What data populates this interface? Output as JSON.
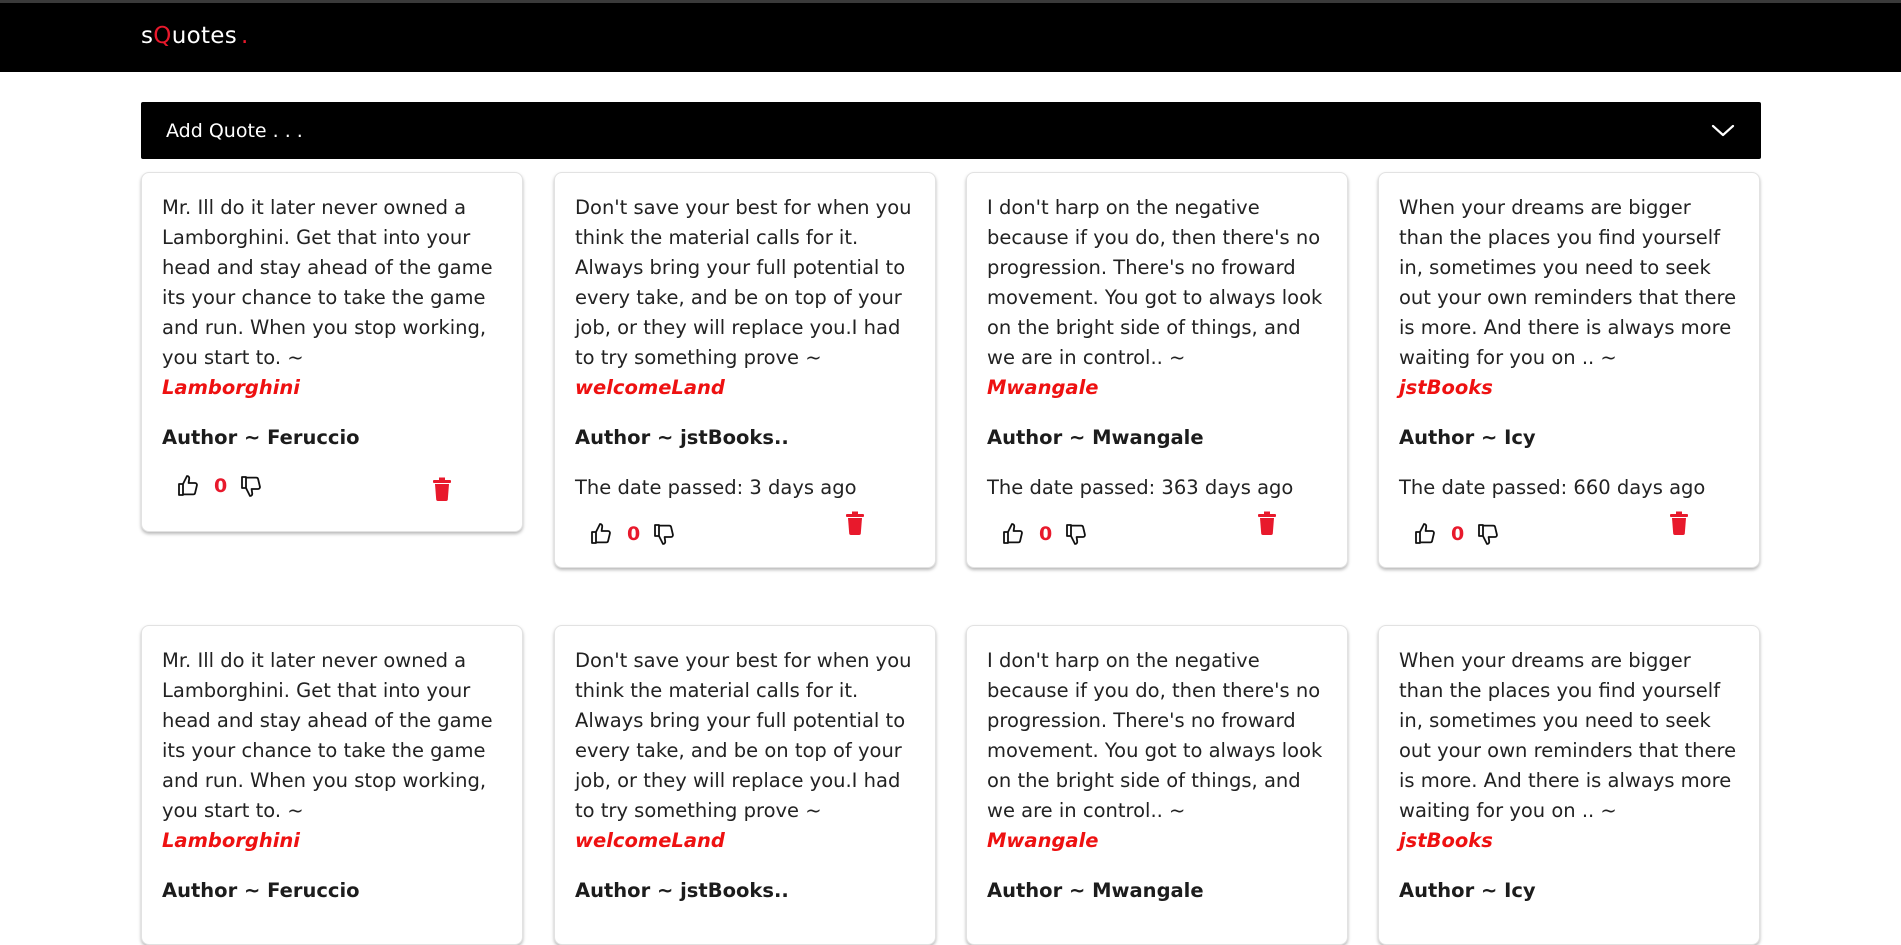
{
  "app": {
    "brand_prefix": "s",
    "brand_accent": "Q",
    "brand_suffix": "uotes",
    "brand_dot": ".",
    "accent_color": "#e8192c"
  },
  "add_quote": {
    "label": "Add Quote . . .",
    "toggle_icon": "chevron-down-icon"
  },
  "cards": [
    {
      "quote": "Mr. Ill do it later never owned a Lamborghini. Get that into your head and stay ahead of the game its your chance to take the game and run. When you stop working, you start to. ~",
      "source": "Lamborghini",
      "author": "Author ~ Feruccio",
      "date": "",
      "votes": "0"
    },
    {
      "quote": "Don't save your best for when you think the material calls for it. Always bring your full potential to every take, and be on top of your job, or they will replace you.I had to try something prove ~",
      "source": "welcomeLand",
      "author": "Author ~ jstBooks..",
      "date": "The date passed: 3 days ago",
      "votes": "0"
    },
    {
      "quote": "I don't harp on the negative because if you do, then there's no progression. There's no froward movement. You got to always look on the bright side of things, and we are in control.. ~",
      "source": "Mwangale",
      "author": "Author ~ Mwangale",
      "date": "The date passed: 363 days ago",
      "votes": "0"
    },
    {
      "quote": "When your dreams are bigger than the places you find yourself in, sometimes you need to seek out your own reminders that there is more. And there is always more waiting for you on .. ~",
      "source": "jstBooks",
      "author": "Author ~ Icy",
      "date": "The date passed: 660 days ago",
      "votes": "0"
    },
    {
      "quote": "Mr. Ill do it later never owned a Lamborghini. Get that into your head and stay ahead of the game its your chance to take the game and run. When you stop working, you start to. ~",
      "source": "Lamborghini",
      "author": "Author ~ Feruccio"
    },
    {
      "quote": "Don't save your best for when you think the material calls for it. Always bring your full potential to every take, and be on top of your job, or they will replace you.I had to try something prove ~",
      "source": "welcomeLand",
      "author": "Author ~ jstBooks.."
    },
    {
      "quote": "I don't harp on the negative because if you do, then there's no progression. There's no froward movement. You got to always look on the bright side of things, and we are in control.. ~",
      "source": "Mwangale",
      "author": "Author ~ Mwangale"
    },
    {
      "quote": "When your dreams are bigger than the places you find yourself in, sometimes you need to seek out your own reminders that there is more. And there is always more waiting for you on .. ~",
      "source": "jstBooks",
      "author": "Author ~ Icy"
    }
  ],
  "icons": {
    "like": "thumbs-up-icon",
    "dislike": "thumbs-down-icon",
    "delete": "trash-icon"
  }
}
